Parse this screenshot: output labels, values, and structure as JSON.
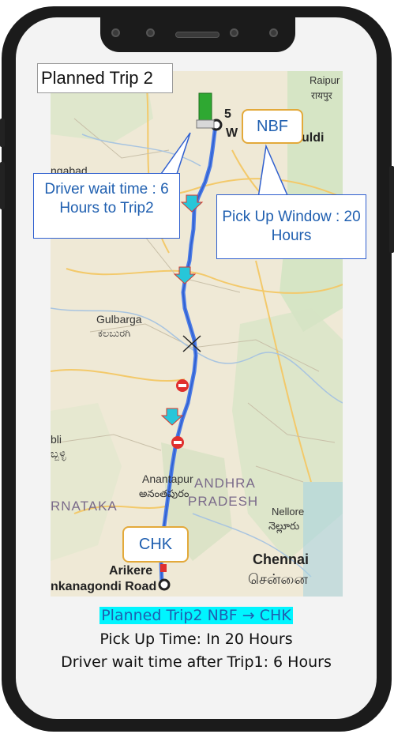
{
  "title": "Planned Trip 2",
  "origin_label": "NBF",
  "destination_label": "CHK",
  "callouts": {
    "driver_wait": "Driver wait time : 6 Hours to Trip2",
    "pickup_window": "Pick Up Window : 20 Hours"
  },
  "map": {
    "places": {
      "raipur": "Raipur",
      "raipur_local": "रायपुर",
      "aurangabad": "ngabad",
      "gulbarga": "Gulbarga",
      "gulbarga_local": "ಕಲಬುರಗಿ",
      "hubli": "bli",
      "hubli_local": "ಬ್ಬಳ್ಳಿ",
      "anantapur": "Anantapur",
      "anantapur_local": "అనంతపురం",
      "andhra": "ANDHRA",
      "pradesh": "PRADESH",
      "karnataka": "RNATAKA",
      "nellore": "Nellore",
      "nellore_local": "నెల్లూరు",
      "chennai": "Chennai",
      "chennai_local": "சென்னை",
      "arikere": "Arikere",
      "road": "nkanagondi Road",
      "origin_partial_1": "5",
      "origin_partial_2": "W",
      "origin_partial_3": "uldi"
    }
  },
  "caption": {
    "line1": "Planned Trip2 NBF → CHK",
    "line2": "Pick Up Time: In 20 Hours",
    "line3": "Driver wait time after Trip1: 6 Hours"
  },
  "colors": {
    "route": "#4b7be6",
    "callout_text": "#1f5fb0",
    "caption_highlight": "#00f5ff",
    "label_border": "#e3a93a",
    "truck": "#2fa832"
  }
}
